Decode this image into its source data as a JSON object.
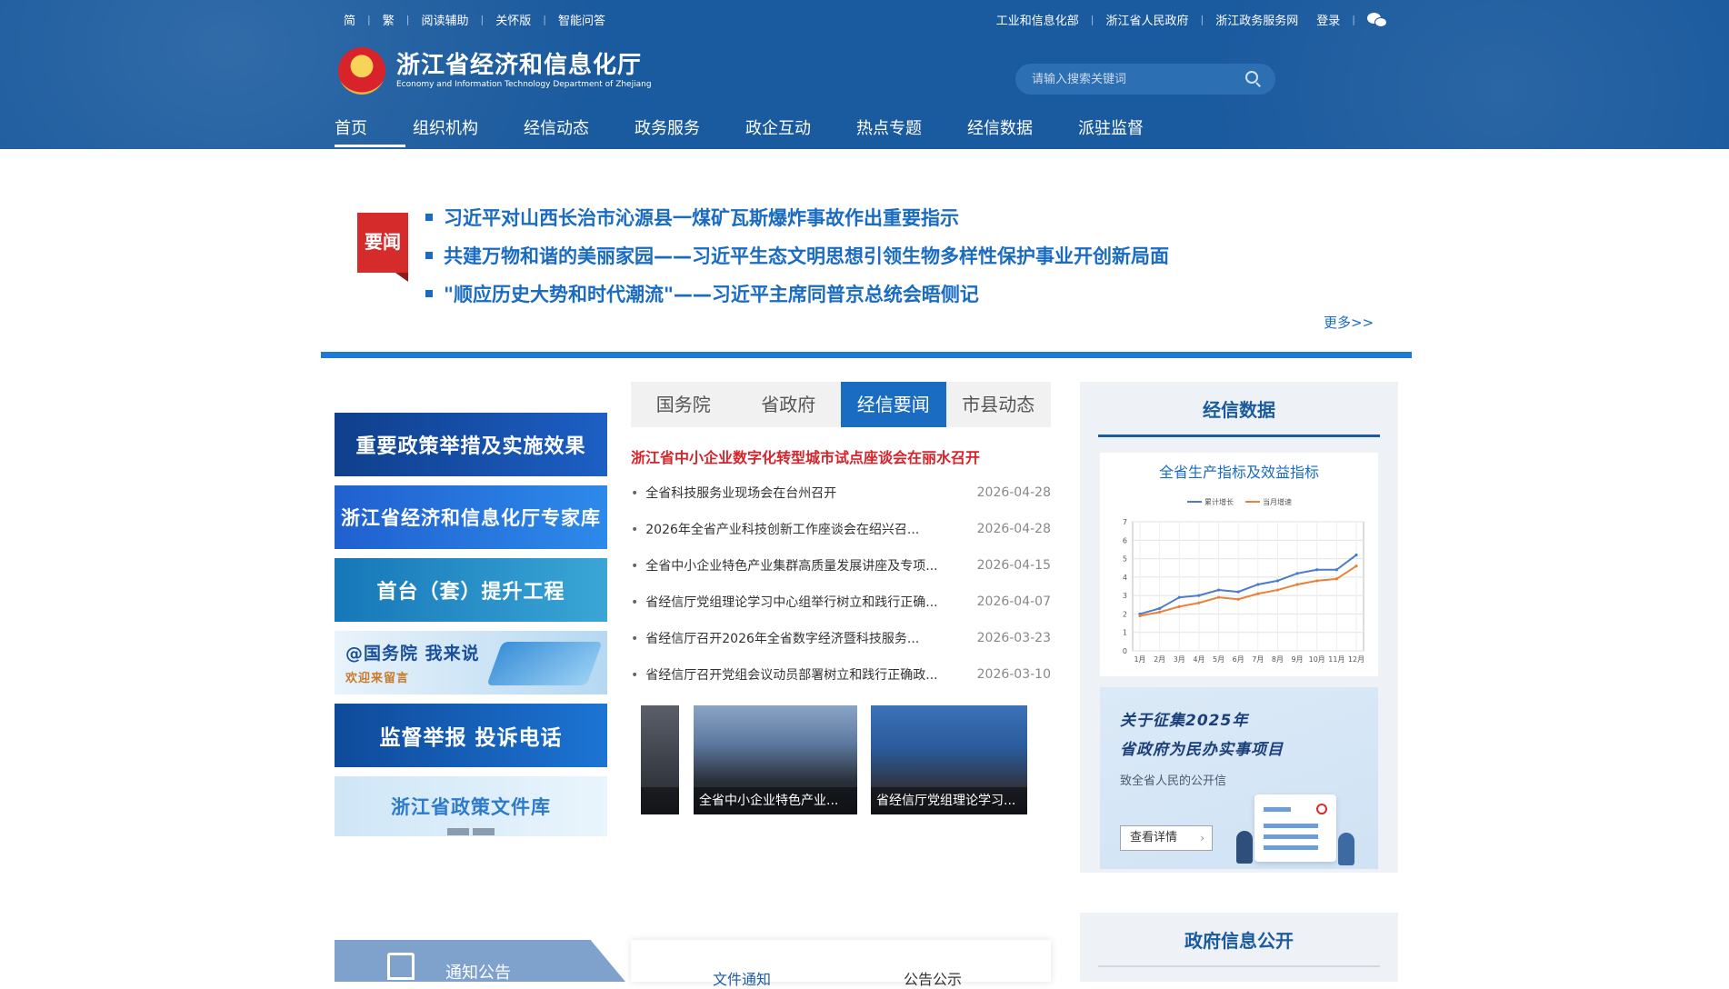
{
  "topbar": {
    "left": [
      "简",
      "繁",
      "阅读辅助",
      "关怀版",
      "智能问答"
    ],
    "right": [
      "工业和信息化部",
      "浙江省人民政府",
      "浙江政务服务网",
      "登录"
    ],
    "wechat_icon": "wechat-icon"
  },
  "logo": {
    "cn": "浙江省经济和信息化厅",
    "en": "Economy and Information Technology Department of Zhejiang"
  },
  "search": {
    "placeholder": "请输入搜索关键词",
    "icon": "search-icon"
  },
  "nav": [
    "首页",
    "组织机构",
    "经信动态",
    "政务服务",
    "政企互动",
    "热点专题",
    "经信数据",
    "派驻监督"
  ],
  "headline": {
    "badge": "要闻",
    "items": [
      "习近平对山西长治市沁源县一煤矿瓦斯爆炸事故作出重要指示",
      "共建万物和谐的美丽家园——习近平生态文明思想引领生物多样性保护事业开创新局面",
      "\"顺应历史大势和时代潮流\"——习近平主席同普京总统会晤侧记"
    ],
    "more": "更多>>"
  },
  "banners": {
    "b1": "重要政策举措及实施效果",
    "b2": "浙江省经济和信息化厅专家库",
    "b3": "首台（套）提升工程",
    "b4_line1": "@国务院 我来说",
    "b4_line2": "欢迎来留言",
    "b5": "监督举报  投诉电话",
    "b6": "浙江省政策文件库"
  },
  "news": {
    "tabs": [
      "国务院",
      "省政府",
      "经信要闻",
      "市县动态"
    ],
    "active_tab": "经信要闻",
    "top": "浙江省中小企业数字化转型城市试点座谈会在丽水召开",
    "items": [
      {
        "title": "全省科技服务业现场会在台州召开",
        "date": "2026-04-28"
      },
      {
        "title": "2026年全省产业科技创新工作座谈会在绍兴召...",
        "date": "2026-04-28"
      },
      {
        "title": "全省中小企业特色产业集群高质量发展讲座及专项...",
        "date": "2026-04-15"
      },
      {
        "title": "省经信厅党组理论学习中心组举行树立和践行正确...",
        "date": "2026-04-07"
      },
      {
        "title": "省经信厅召开2026年全省数字经济暨科技服务...",
        "date": "2026-03-23"
      },
      {
        "title": "省经信厅召开党组会议动员部署树立和践行正确政...",
        "date": "2026-03-10"
      }
    ],
    "photos": [
      "",
      "全省中小企业特色产业...",
      "省经信厅党组理论学习..."
    ]
  },
  "data_panel": {
    "title": "经信数据",
    "chart_title": "全省生产指标及效益指标"
  },
  "chart_data": {
    "type": "line",
    "categories": [
      "1月",
      "2月",
      "3月",
      "4月",
      "5月",
      "6月",
      "7月",
      "8月",
      "9月",
      "10月",
      "11月",
      "12月"
    ],
    "series": [
      {
        "name": "累计增长",
        "color": "#4a7cc8",
        "values": [
          2.0,
          2.3,
          2.9,
          3.0,
          3.3,
          3.2,
          3.6,
          3.8,
          4.2,
          4.4,
          4.4,
          5.2
        ]
      },
      {
        "name": "当月增速",
        "color": "#e8823a",
        "values": [
          1.9,
          2.1,
          2.4,
          2.6,
          2.9,
          2.8,
          3.1,
          3.3,
          3.6,
          3.8,
          3.9,
          4.6
        ]
      }
    ],
    "ylim": [
      0,
      7
    ],
    "yticks": [
      "0",
      "1",
      "2",
      "3",
      "4",
      "5",
      "6",
      "7"
    ],
    "grid": true,
    "legend": "top"
  },
  "appeal": {
    "line1": "关于征集2025年",
    "line2": "省政府为民办实事项目",
    "line3": "致全省人民的公开信",
    "button": "查看详情",
    "arrow": "›"
  },
  "gov_info": {
    "title": "政府信息公开"
  },
  "bottom": {
    "notice": "通知公告",
    "doc_tabs": [
      "文件通知",
      "公告公示"
    ]
  },
  "colors": {
    "header": "#1a5a9e",
    "accent": "#1a6bc2",
    "badge": "#d62b2b"
  }
}
